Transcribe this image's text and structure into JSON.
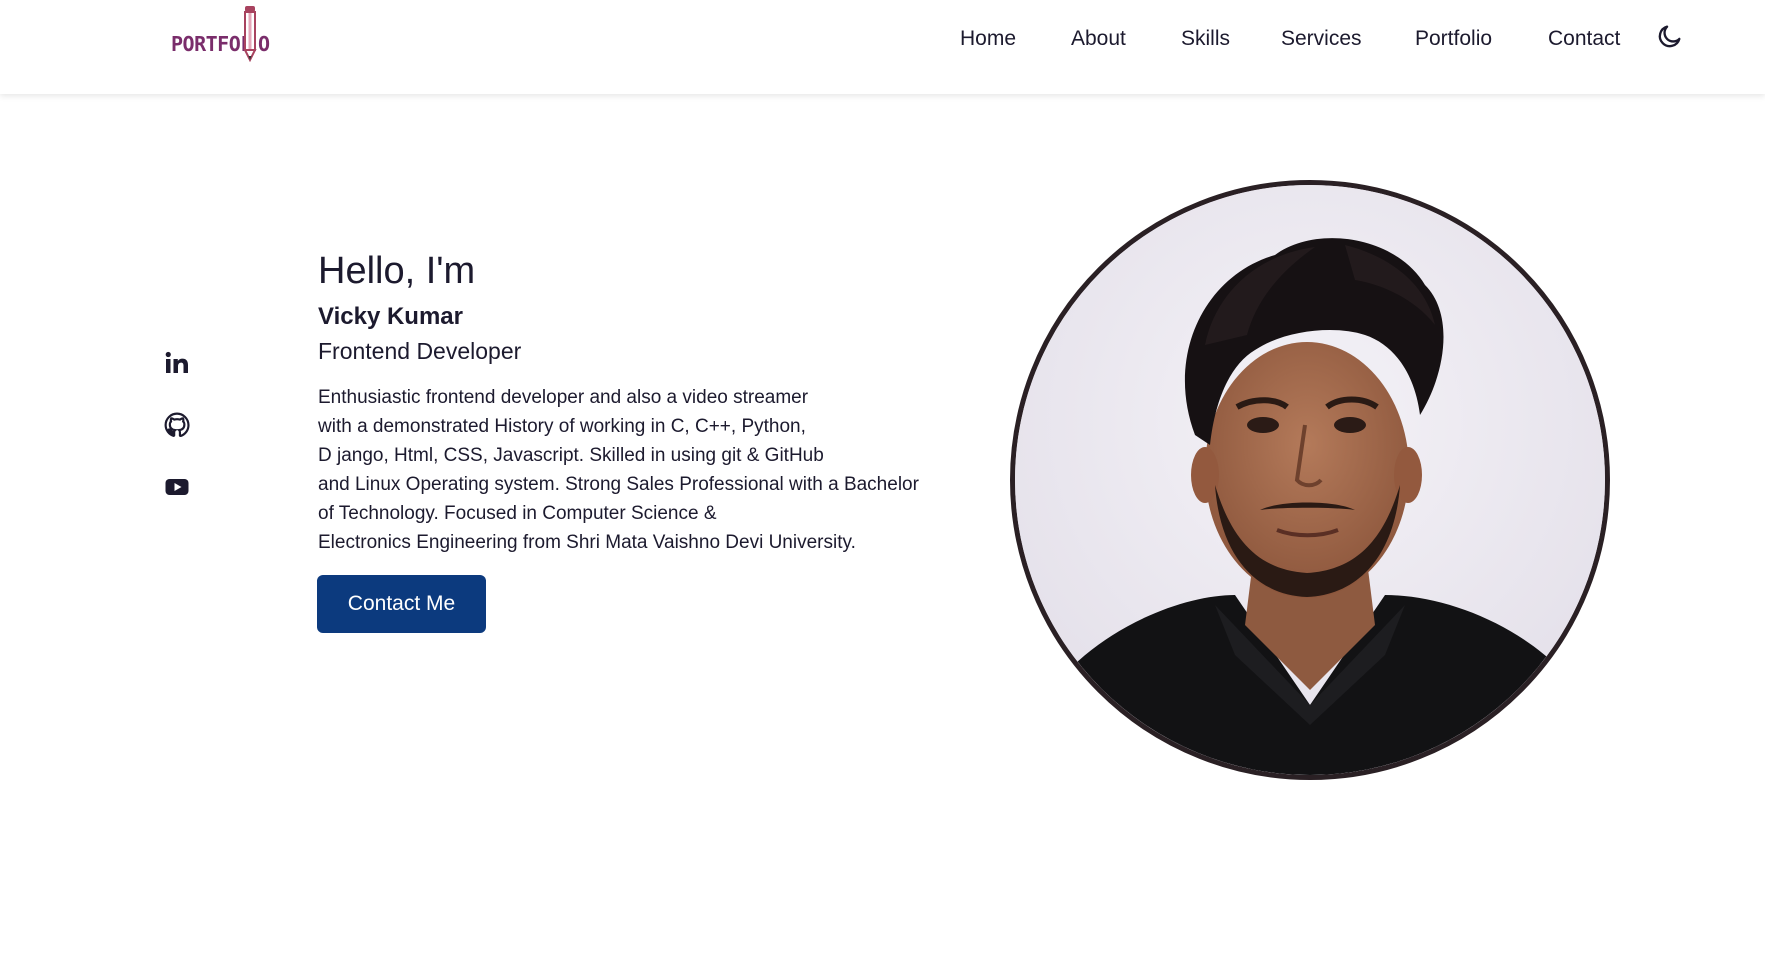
{
  "header": {
    "logo_text_left": "PORTFOL",
    "logo_text_right": "O",
    "nav": [
      {
        "label": "Home"
      },
      {
        "label": "About"
      },
      {
        "label": "Skills"
      },
      {
        "label": "Services"
      },
      {
        "label": "Portfolio"
      },
      {
        "label": "Contact"
      }
    ],
    "theme_icon": "moon-icon"
  },
  "social": [
    {
      "icon": "linkedin-icon",
      "label": "in"
    },
    {
      "icon": "github-icon"
    },
    {
      "icon": "youtube-icon"
    }
  ],
  "hero": {
    "greeting": "Hello, I'm",
    "name": "Vicky Kumar",
    "role": "Frontend Developer",
    "description_lines": [
      "Enthusiastic frontend developer and also a video streamer",
      "with a demonstrated History of working in C, C++, Python,",
      "D jango, Html, CSS, Javascript. Skilled in using git & GitHub",
      "and Linux Operating system. Strong Sales Professional with a Bachelor",
      "of Technology. Focused in Computer Science &",
      "Electronics Engineering from Shri Mata Vaishno Devi University."
    ],
    "cta_label": "Contact Me",
    "avatar_icon": "profile-photo"
  },
  "colors": {
    "primary": "#0c3a7e",
    "text": "#1c1a2e",
    "logo": "#7a2d6b",
    "avatar_border": "#2a2024"
  }
}
